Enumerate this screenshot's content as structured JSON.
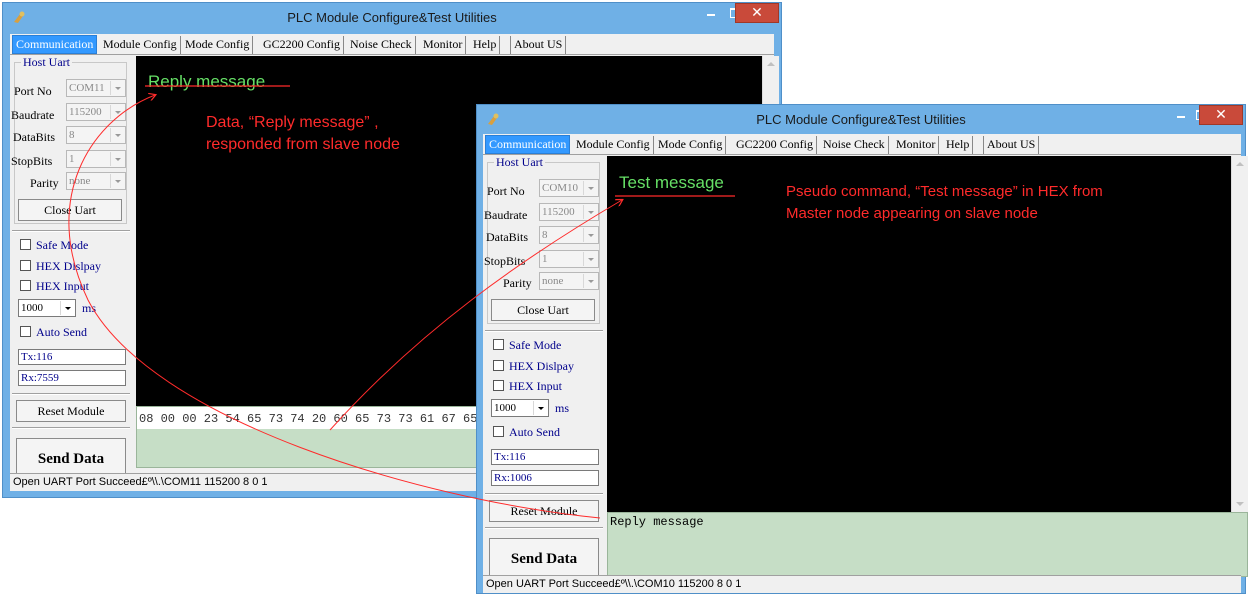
{
  "window1": {
    "title": "PLC Module Configure&Test Utilities",
    "tabs": [
      "Communication",
      "Module Config",
      "Mode Config",
      "GC2200 Config",
      "Noise Check",
      "Monitor",
      "Help",
      "About US"
    ],
    "host_uart": "Host Uart",
    "port_label": "Port No",
    "port_value": "COM11",
    "baud_label": "Baudrate",
    "baud_value": "115200",
    "databits_label": "DataBits",
    "databits_value": "8",
    "stopbits_label": "StopBits",
    "stopbits_value": "1",
    "parity_label": "Parity",
    "parity_value": "none",
    "close_uart": "Close Uart",
    "safe_mode": "Safe Mode",
    "hex_display": "HEX Dislpay",
    "hex_input": "HEX Input",
    "interval_value": "1000",
    "interval_unit": "ms",
    "auto_send": "Auto Send",
    "tx_count": "Tx:116",
    "rx_count": "Rx:7559",
    "reset_module": "Reset Module",
    "send_data": "Send Data",
    "terminal_text": "Reply message",
    "hex_input_text": "08 00 00 23 54 65 73 74 20 60 65 73 73 61 67 65",
    "status": "Open UART Port Succeed£º\\\\.\\COM11 115200 8 0 1"
  },
  "window2": {
    "title": "PLC Module Configure&Test Utilities",
    "tabs": [
      "Communication",
      "Module Config",
      "Mode Config",
      "GC2200 Config",
      "Noise Check",
      "Monitor",
      "Help",
      "About US"
    ],
    "host_uart": "Host Uart",
    "port_label": "Port No",
    "port_value": "COM10",
    "baud_label": "Baudrate",
    "baud_value": "115200",
    "databits_label": "DataBits",
    "databits_value": "8",
    "stopbits_label": "StopBits",
    "stopbits_value": "1",
    "parity_label": "Parity",
    "parity_value": "none",
    "close_uart": "Close Uart",
    "safe_mode": "Safe Mode",
    "hex_display": "HEX Dislpay",
    "hex_input": "HEX Input",
    "interval_value": "1000",
    "interval_unit": "ms",
    "auto_send": "Auto Send",
    "tx_count": "Tx:116",
    "rx_count": "Rx:1006",
    "reset_module": "Reset Module",
    "send_data": "Send Data",
    "terminal_text": "Test message",
    "tx_text": "Reply message",
    "status": "Open UART Port Succeed£º\\\\.\\COM10 115200 8 0 1"
  },
  "annotations": {
    "reply_line1": "Data, “Reply message” ,",
    "reply_line2": "responded from slave node",
    "pseudo_line1": "Pseudo  command, “Test message” in HEX  from",
    "pseudo_line2": "Master node  appearing on slave node"
  },
  "colors": {
    "titlebar": "#6fb0e6",
    "terminal_bg": "#000000",
    "terminal_text": "#66e066",
    "send_area": "#c6dec6",
    "annotation": "#ff2b2b",
    "active_tab": "#3399ff"
  }
}
